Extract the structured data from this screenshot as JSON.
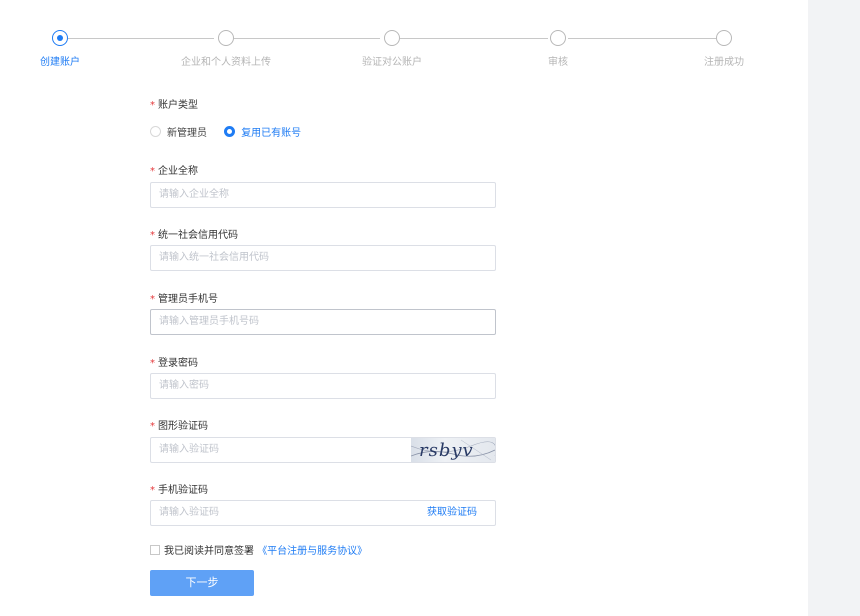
{
  "steps": [
    {
      "label": "创建账户",
      "active": true
    },
    {
      "label": "企业和个人资料上传",
      "active": false
    },
    {
      "label": "验证对公账户",
      "active": false
    },
    {
      "label": "审核",
      "active": false
    },
    {
      "label": "注册成功",
      "active": false
    }
  ],
  "form": {
    "account_type": {
      "label": "账户类型",
      "required_mark": "*",
      "options": [
        "新管理员",
        "复用已有账号"
      ],
      "selected": "复用已有账号"
    },
    "company_name": {
      "label": "企业全称",
      "required_mark": "*",
      "value": "",
      "placeholder": "请输入企业全称"
    },
    "credit_code": {
      "label": "统一社会信用代码",
      "required_mark": "*",
      "value": "",
      "placeholder": "请输入统一社会信用代码"
    },
    "admin_phone": {
      "label": "管理员手机号",
      "required_mark": "*",
      "value": "",
      "placeholder": "请输入管理员手机号码"
    },
    "password": {
      "label": "登录密码",
      "required_mark": "*",
      "value": "",
      "placeholder": "请输入密码"
    },
    "image_captcha": {
      "label": "图形验证码",
      "required_mark": "*",
      "value": "",
      "placeholder": "请输入验证码",
      "captcha_text": "rsbyv"
    },
    "sms_code": {
      "label": "手机验证码",
      "required_mark": "*",
      "value": "",
      "placeholder": "请输入验证码",
      "get_code_label": "获取验证码"
    },
    "agreement": {
      "text": "我已阅读并同意签署",
      "link": "《平台注册与服务协议》",
      "checked": false
    },
    "next_label": "下一步"
  },
  "colors": {
    "accent": "#1f7cf4",
    "button": "#5fa1f6",
    "required": "#e4393c",
    "inactive": "#b5b5b5"
  }
}
